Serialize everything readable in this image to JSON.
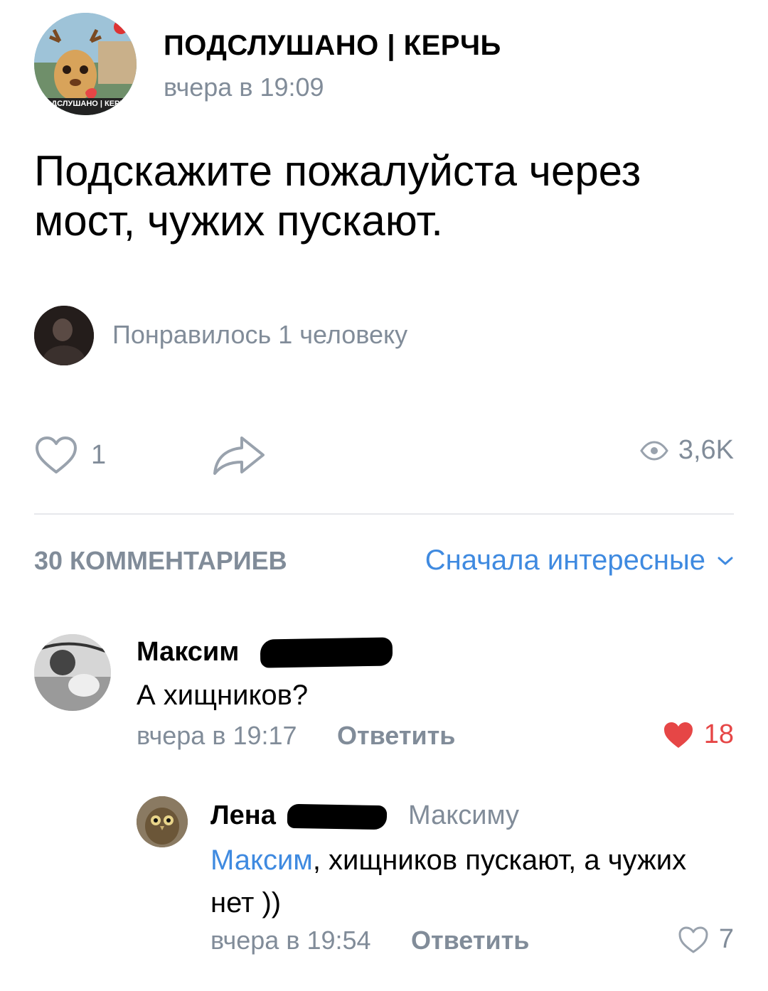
{
  "post": {
    "group_name": "ПОДСЛУШАНО | КЕРЧЬ",
    "time": "вчера в 19:09",
    "text": "Подскажите пожалуйста через мост, чужих пускают.",
    "avatar_icon": "deer-mascot-avatar",
    "avatar_caption": "ПОДСЛУШАНО | КЕРЧЬ",
    "liked_by_text": "Понравилось 1 человеку",
    "like_count": "1",
    "views": "3,6K"
  },
  "comments_header": {
    "count_label": "30 КОММЕНТАРИЕВ",
    "sort_label": "Сначала интересные"
  },
  "comments": [
    {
      "author_first": "Максим",
      "text": "А хищников?",
      "time": "вчера в 19:17",
      "reply_label": "Ответить",
      "likes": "18",
      "liked": true
    },
    {
      "author_first": "Лена",
      "reply_to": "Максиму",
      "mention": "Максим",
      "text_rest": ", хищников пускают, а чужих нет ))",
      "time": "вчера в 19:54",
      "reply_label": "Ответить",
      "likes": "7",
      "liked": false
    }
  ],
  "colors": {
    "accent": "#3f8ae0",
    "secondary_text": "#818c99",
    "like_red": "#e64646",
    "divider": "#e7e8ec"
  }
}
